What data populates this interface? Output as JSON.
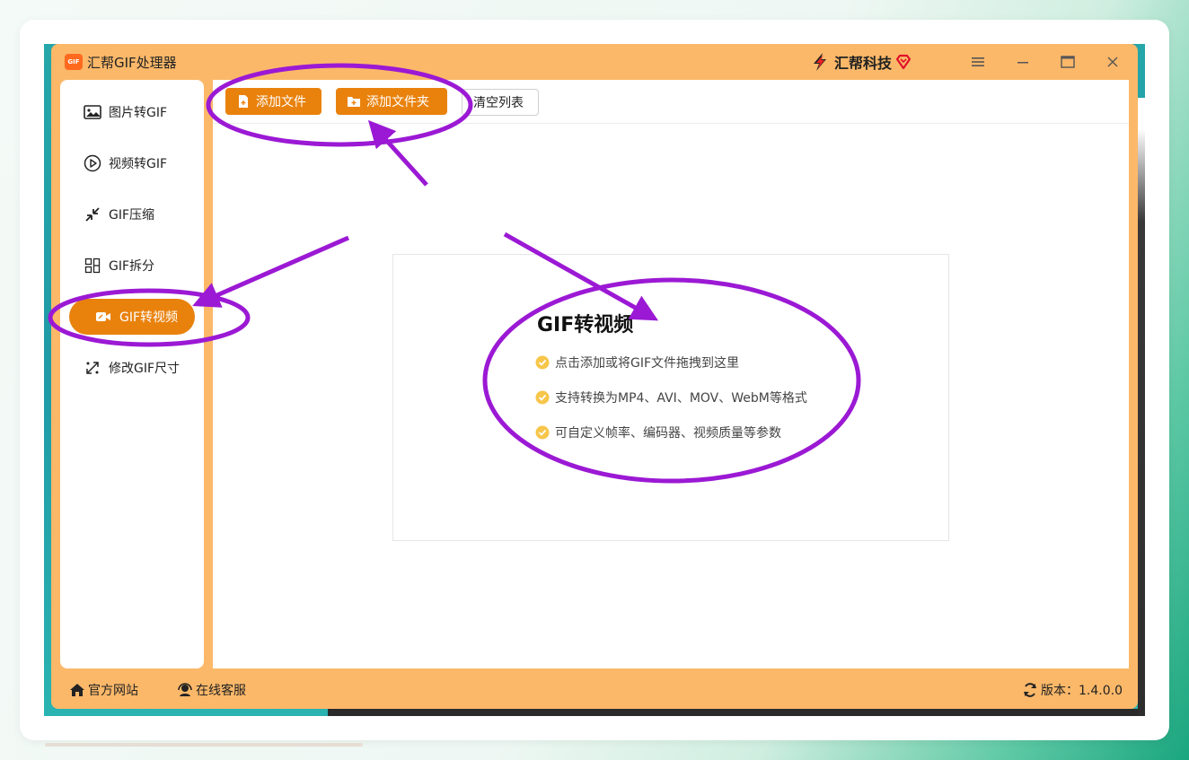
{
  "app": {
    "title": "汇帮GIF处理器",
    "logo_text": "GIF",
    "brand": "汇帮科技"
  },
  "sidebar": {
    "items": [
      {
        "label": "图片转GIF",
        "icon": "image-icon"
      },
      {
        "label": "视频转GIF",
        "icon": "play-circle-icon"
      },
      {
        "label": "GIF压缩",
        "icon": "compress-icon"
      },
      {
        "label": "GIF拆分",
        "icon": "split-icon"
      },
      {
        "label": "GIF转视频",
        "icon": "video-camera-icon",
        "active": true
      },
      {
        "label": "修改GIF尺寸",
        "icon": "resize-icon"
      }
    ]
  },
  "toolbar": {
    "add_file": "添加文件",
    "add_folder": "添加文件夹",
    "clear_list": "清空列表"
  },
  "dropzone": {
    "title": "GIF转视频",
    "items": [
      "点击添加或将GIF文件拖拽到这里",
      "支持转换为MP4、AVI、MOV、WebM等格式",
      "可自定义帧率、编码器、视频质量等参数"
    ]
  },
  "footer": {
    "website": "官方网站",
    "support": "在线客服",
    "version": "版本：1.4.0.0"
  },
  "colors": {
    "accent": "#e9820d",
    "frame": "#fbb869",
    "annotation": "#9b19d4",
    "check": "#f7c64a"
  }
}
